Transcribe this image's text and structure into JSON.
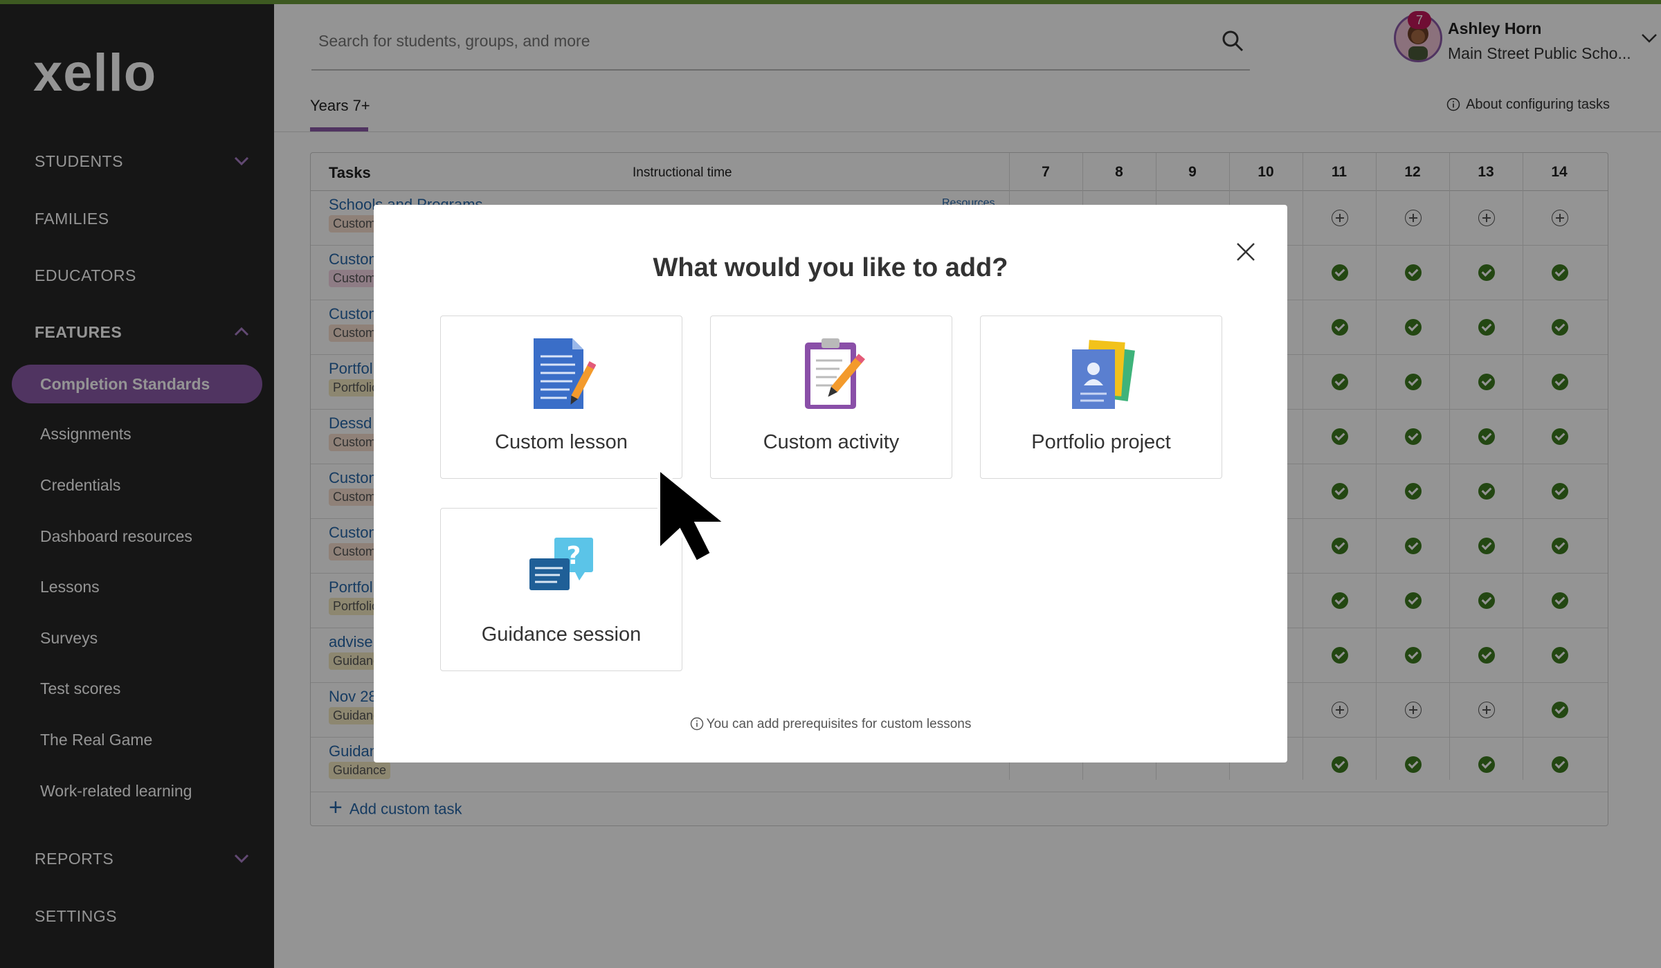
{
  "app": {
    "logo": "xello"
  },
  "sidebar": {
    "students": "STUDENTS",
    "families": "FAMILIES",
    "educators": "EDUCATORS",
    "features": "FEATURES",
    "items": [
      {
        "label": "Completion Standards",
        "active": true
      },
      {
        "label": "Assignments"
      },
      {
        "label": "Credentials"
      },
      {
        "label": "Dashboard resources"
      },
      {
        "label": "Lessons"
      },
      {
        "label": "Surveys"
      },
      {
        "label": "Test scores"
      },
      {
        "label": "The Real Game"
      },
      {
        "label": "Work-related learning"
      }
    ],
    "reports": "REPORTS",
    "settings": "SETTINGS"
  },
  "header": {
    "search_placeholder": "Search for students, groups, and more",
    "notification_count": "7",
    "user_name": "Ashley Horn",
    "user_school": "Main Street Public Scho..."
  },
  "tabs": {
    "active": "Years 7+",
    "about": "About configuring tasks"
  },
  "table": {
    "col_tasks": "Tasks",
    "col_time": "Instructional time",
    "years": [
      "7",
      "8",
      "9",
      "10",
      "11",
      "12",
      "13",
      "14"
    ],
    "resources_label": "Resources",
    "rows": [
      {
        "title": "Schools and Programs",
        "tag": "Custom",
        "tagc": "orange",
        "cells": [
          "plus",
          "plus",
          "plus",
          "plus",
          "plus",
          "plus",
          "plus",
          "plus"
        ]
      },
      {
        "title": "Custom",
        "tag": "Custom",
        "tagc": "pink",
        "cells": [
          "",
          "",
          "",
          "",
          "check",
          "check",
          "check",
          "check"
        ]
      },
      {
        "title": "Custom",
        "tag": "Custom",
        "tagc": "orange",
        "cells": [
          "",
          "",
          "",
          "",
          "check",
          "check",
          "check",
          "check"
        ]
      },
      {
        "title": "Portfolio",
        "tag": "Portfolio",
        "tagc": "yellow",
        "cells": [
          "",
          "",
          "",
          "",
          "check",
          "check",
          "check",
          "check"
        ]
      },
      {
        "title": "Dessd",
        "tag": "Custom",
        "tagc": "orange",
        "cells": [
          "",
          "",
          "",
          "",
          "check",
          "check",
          "check",
          "check"
        ]
      },
      {
        "title": "Custom",
        "tag": "Custom",
        "tagc": "orange",
        "cells": [
          "",
          "",
          "",
          "",
          "check",
          "check",
          "check",
          "check"
        ]
      },
      {
        "title": "Custom",
        "tag": "Custom",
        "tagc": "orange",
        "cells": [
          "",
          "",
          "",
          "",
          "check",
          "check",
          "check",
          "check"
        ]
      },
      {
        "title": "Portfolio",
        "tag": "Portfolio",
        "tagc": "yellow",
        "cells": [
          "",
          "",
          "",
          "",
          "check",
          "check",
          "check",
          "check"
        ]
      },
      {
        "title": "advise",
        "tag": "Guidance",
        "tagc": "yellow",
        "cells": [
          "",
          "",
          "",
          "",
          "check",
          "check",
          "check",
          "check"
        ]
      },
      {
        "title": "Nov 28",
        "tag": "Guidance",
        "tagc": "yellow",
        "cells": [
          "",
          "",
          "",
          "",
          "plus",
          "plus",
          "plus",
          "check"
        ]
      },
      {
        "title": "Guidance",
        "tag": "Guidance",
        "tagc": "yellow",
        "cells": [
          "",
          "",
          "",
          "",
          "check",
          "check",
          "check",
          "check"
        ]
      }
    ],
    "add_task": "Add custom task"
  },
  "modal": {
    "title": "What would you like to add?",
    "options": [
      {
        "label": "Custom lesson",
        "icon": "lesson-document-icon"
      },
      {
        "label": "Custom activity",
        "icon": "clipboard-icon"
      },
      {
        "label": "Portfolio project",
        "icon": "portfolio-icon"
      },
      {
        "label": "Guidance session",
        "icon": "guidance-chat-icon"
      }
    ],
    "note": "You can add prerequisites for custom lessons"
  },
  "colors": {
    "accent": "#8a5aa8",
    "sidebar": "#262626",
    "check": "#3d7a1f",
    "link": "#2766a8"
  }
}
